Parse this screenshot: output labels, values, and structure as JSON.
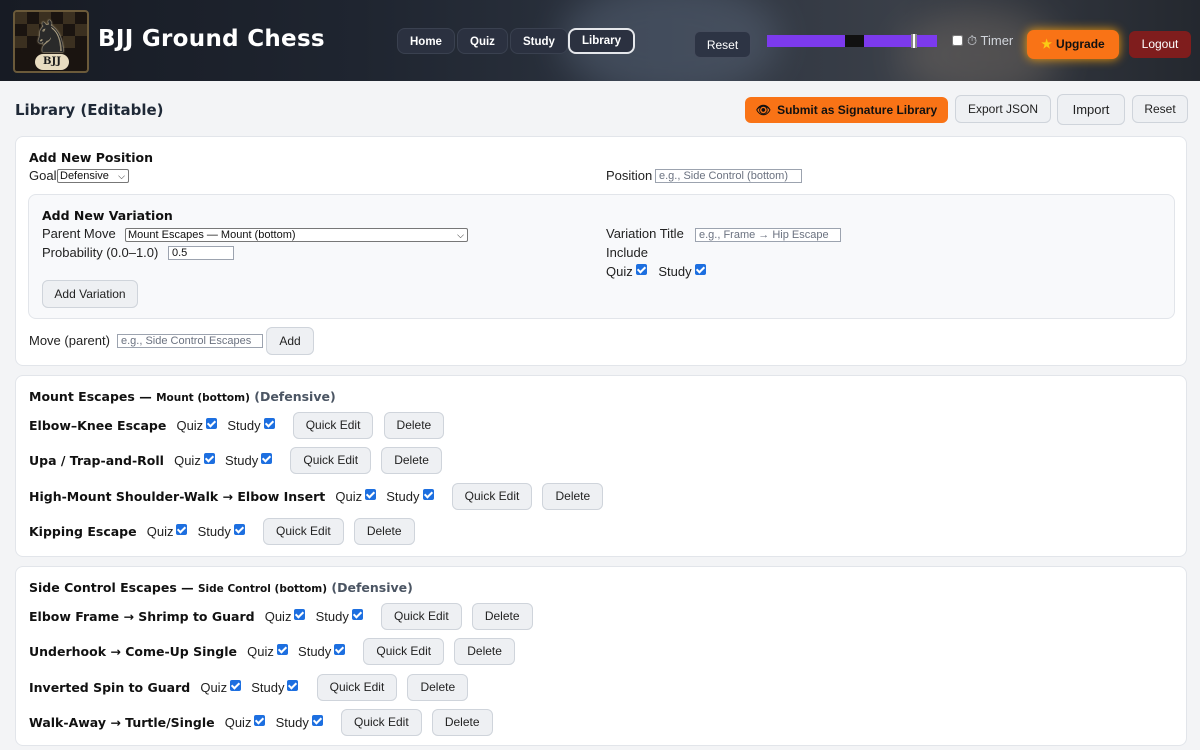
{
  "header": {
    "brand": "BJJ Ground Chess",
    "logo_text": "BJJ",
    "nav": [
      "Home",
      "Quiz",
      "Study",
      "Library"
    ],
    "active_nav": "Library",
    "reset_label": "Reset",
    "timer_label": "⏱ Timer",
    "upgrade_label": "Upgrade",
    "logout_label": "Logout",
    "colors": {
      "upgrade": "#f97316",
      "logout": "#7f1d1d",
      "progress": "#7c3aed"
    }
  },
  "page": {
    "title": "Library (Editable)",
    "submit_label": "Submit as Signature Library",
    "export_label": "Export JSON",
    "import_label": "Import",
    "reset_label": "Reset"
  },
  "add_position": {
    "title": "Add New Position",
    "goal_label": "Goal",
    "goal_value": "Defensive",
    "position_label": "Position",
    "position_placeholder": "e.g., Side Control (bottom)",
    "variation": {
      "title": "Add New Variation",
      "parent_label": "Parent Move",
      "parent_value": "Mount Escapes — Mount (bottom)",
      "prob_label": "Probability (0.0–1.0)",
      "prob_value": "0.5",
      "vtitle_label": "Variation Title",
      "vtitle_placeholder": "e.g., Frame → Hip Escape",
      "include_label": "Include",
      "quiz_label": "Quiz",
      "study_label": "Study",
      "add_label": "Add Variation"
    },
    "move_label": "Move (parent)",
    "move_placeholder": "e.g., Side Control Escapes",
    "add_label": "Add"
  },
  "groups": [
    {
      "name": "Mount Escapes —",
      "position": "Mount (bottom)",
      "goal": "(Defensive)",
      "variations": [
        "Elbow–Knee Escape",
        "Upa / Trap-and-Roll",
        "High-Mount Shoulder-Walk → Elbow Insert",
        "Kipping Escape"
      ]
    },
    {
      "name": "Side Control Escapes —",
      "position": "Side Control (bottom)",
      "goal": "(Defensive)",
      "variations": [
        "Elbow Frame → Shrimp to Guard",
        "Underhook → Come-Up Single",
        "Inverted Spin to Guard",
        "Walk-Away → Turtle/Single"
      ]
    }
  ],
  "row_labels": {
    "quiz": "Quiz",
    "study": "Study",
    "edit": "Quick Edit",
    "delete": "Delete"
  }
}
